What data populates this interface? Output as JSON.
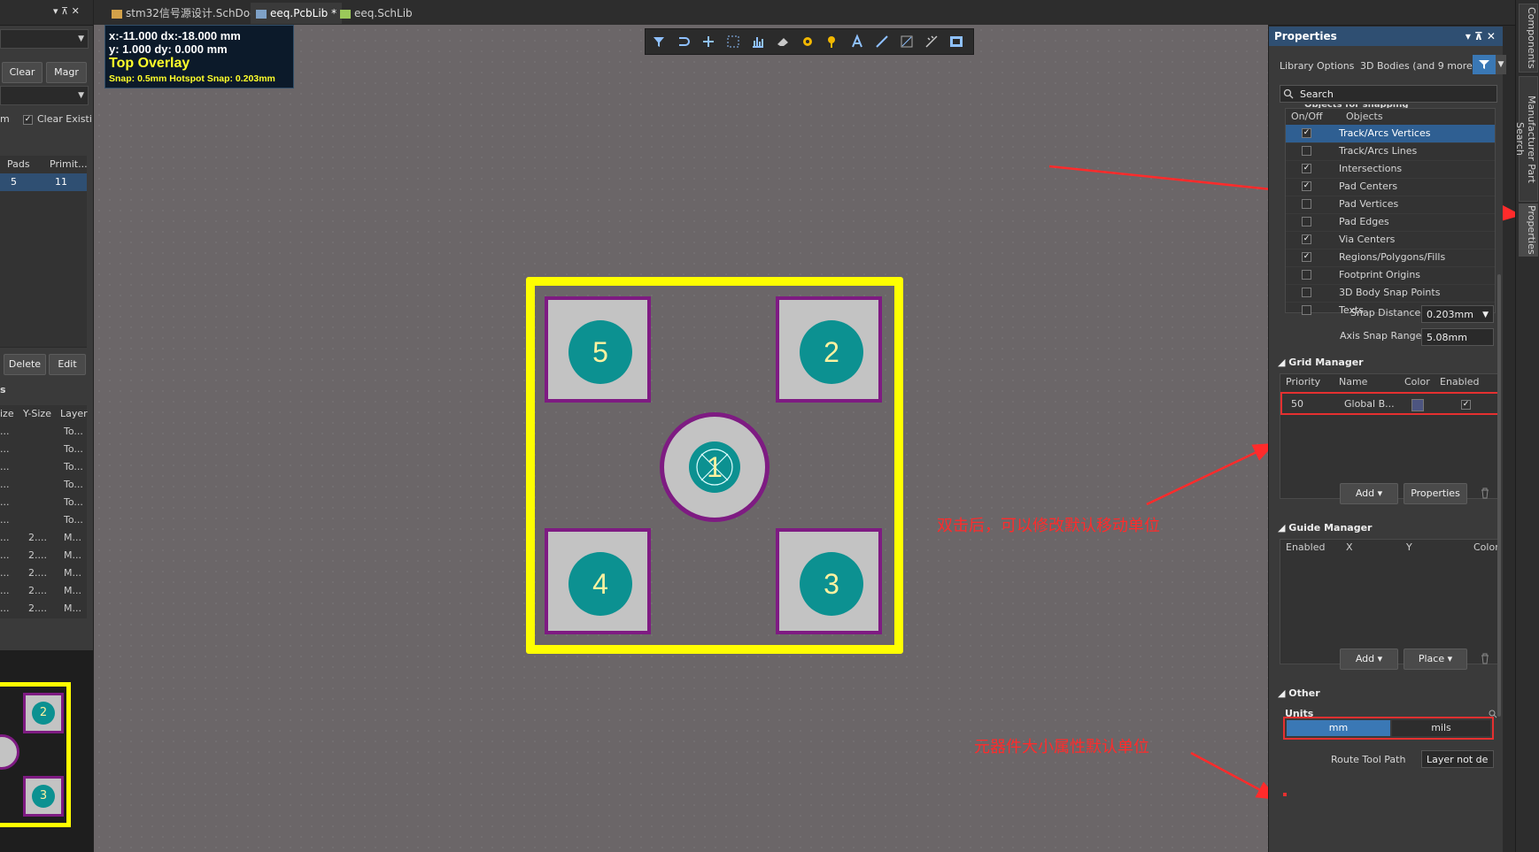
{
  "tabs": [
    {
      "label": "stm32信号源设计.SchDoc"
    },
    {
      "label": "eeq.PcbLib *"
    },
    {
      "label": "eeq.SchLib"
    }
  ],
  "left_panel": {
    "header_controls": "▾ ⊼ ✕",
    "clear_label": "Clear",
    "magnify_label": "Magr",
    "option_label": "m",
    "clear_existing_label": "Clear Existi",
    "table1_headers": [
      "Pads",
      "Primit..."
    ],
    "table1_row": [
      "5",
      "11"
    ],
    "delete_label": "Delete",
    "edit_label": "Edit",
    "section_label": "s",
    "table2_headers": [
      "ize",
      "Y-Size",
      "Layer"
    ],
    "table2_rows": [
      [
        "...",
        "",
        "To..."
      ],
      [
        "...",
        "",
        "To..."
      ],
      [
        "...",
        "",
        "To..."
      ],
      [
        "...",
        "",
        "To..."
      ],
      [
        "...",
        "",
        "To..."
      ],
      [
        "...",
        "",
        "To..."
      ],
      [
        "...",
        "2....",
        "M..."
      ],
      [
        "...",
        "2....",
        "M..."
      ],
      [
        "...",
        "2....",
        "M..."
      ],
      [
        "...",
        "2....",
        "M..."
      ],
      [
        "...",
        "2....",
        "M..."
      ]
    ],
    "preview_pads": [
      "2",
      "3"
    ]
  },
  "hud": {
    "line1": "x:-11.000   dx:-18.000  mm",
    "line2": "y:  1.000    dy:  0.000   mm",
    "layer": "Top Overlay",
    "snap": "Snap: 0.5mm Hotspot Snap: 0.203mm"
  },
  "toolbar_icons": [
    "filter-icon",
    "snap-icon",
    "crosshair-icon",
    "select-rect-icon",
    "chart-icon",
    "eraser-icon",
    "via-icon",
    "pad-key-icon",
    "text-icon",
    "line-icon",
    "region-icon",
    "measure-icon",
    "frame-icon"
  ],
  "footprint": {
    "pads": [
      "5",
      "2",
      "1",
      "4",
      "3"
    ],
    "colors": {
      "outline": "#ffff00",
      "pad_border": "#7e1b82",
      "pad_fill": "#c3c3c3",
      "pad_circle": "#0c9191"
    }
  },
  "annotations": {
    "note1": "双击后，可以修改默认移动单位",
    "note2": "元器件大小属性默认单位"
  },
  "properties": {
    "title": "Properties",
    "title_controls": "▾ ⊼ ✕",
    "library_options": "Library Options",
    "bodies_more": "3D Bodies (and 9 more)",
    "search_placeholder": "Search",
    "partial_section": "Objects for snapping",
    "objects_headers": [
      "On/Off",
      "Objects"
    ],
    "objects": [
      {
        "label": "Track/Arcs Vertices",
        "checked": "✓"
      },
      {
        "label": "Track/Arcs Lines",
        "checked": ""
      },
      {
        "label": "Intersections",
        "checked": "✓"
      },
      {
        "label": "Pad Centers",
        "checked": "✓"
      },
      {
        "label": "Pad Vertices",
        "checked": ""
      },
      {
        "label": "Pad Edges",
        "checked": ""
      },
      {
        "label": "Via Centers",
        "checked": "✓"
      },
      {
        "label": "Regions/Polygons/Fills",
        "checked": "✓"
      },
      {
        "label": "Footprint Origins",
        "checked": ""
      },
      {
        "label": "3D Body Snap Points",
        "checked": ""
      },
      {
        "label": "Texts",
        "checked": ""
      }
    ],
    "snap_distance_label": "Snap Distance",
    "snap_distance_value": "0.203mm",
    "axis_snap_label": "Axis Snap Range",
    "axis_snap_value": "5.08mm",
    "grid_manager": {
      "title": "Grid Manager",
      "headers": [
        "Priority",
        "Name",
        "Color",
        "Enabled"
      ],
      "row": {
        "priority": "50",
        "name": "Global B...",
        "enabled": "✓"
      },
      "add_label": "Add",
      "properties_label": "Properties"
    },
    "guide_manager": {
      "title": "Guide Manager",
      "headers": [
        "Enabled",
        "X",
        "Y",
        "Color"
      ],
      "add_label": "Add",
      "place_label": "Place"
    },
    "other": {
      "title": "Other",
      "units_label": "Units",
      "unit_mm": "mm",
      "unit_mils": "mils",
      "route_tool_label": "Route Tool Path",
      "route_tool_value": "Layer not de"
    }
  },
  "vertical_tabs": [
    "Components",
    "Manufacturer Part Search",
    "Properties"
  ]
}
